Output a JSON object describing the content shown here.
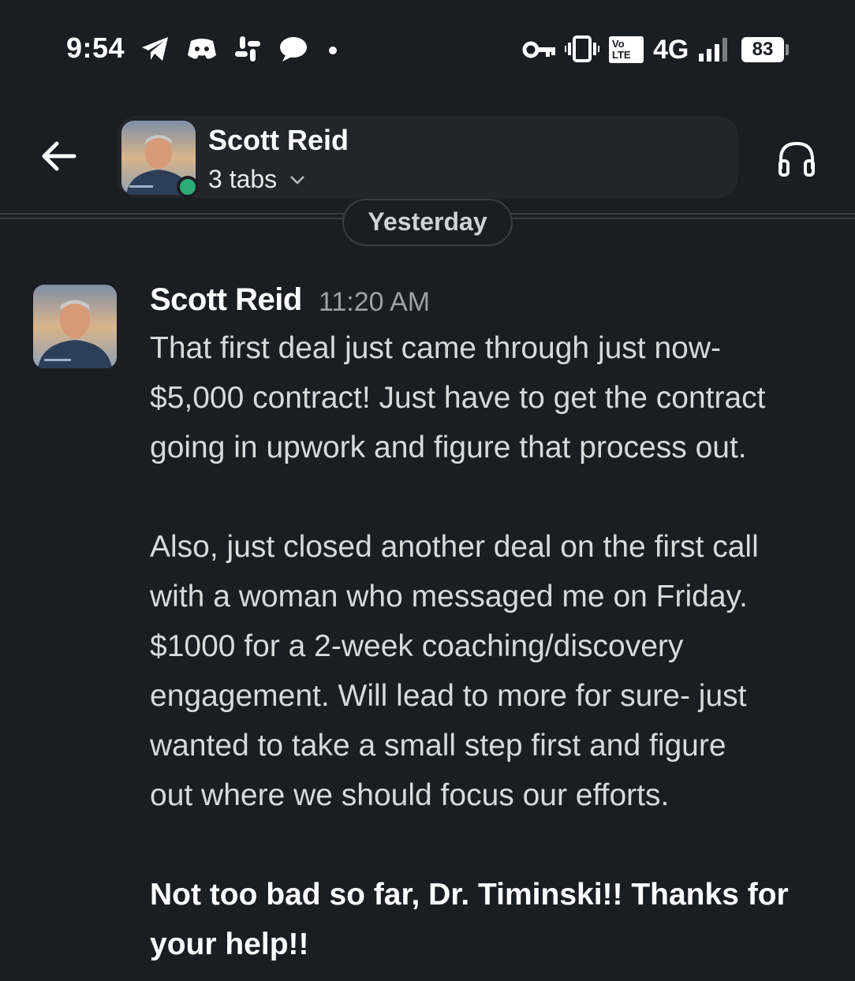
{
  "status_bar": {
    "time": "9:54",
    "network": "4G",
    "volte": "Vo\nLTE",
    "battery": "83",
    "icons": [
      "telegram-icon",
      "discord-icon",
      "slack-icon",
      "chat-bubble-icon",
      "dot-icon",
      "vpn-key-icon",
      "vibrate-icon",
      "signal-icon"
    ]
  },
  "header": {
    "name": "Scott Reid",
    "subtitle": "3 tabs",
    "presence": "online"
  },
  "divider": {
    "date_label": "Yesterday"
  },
  "message": {
    "author": "Scott Reid",
    "time": "11:20 AM",
    "paragraph_1": "That first deal just came through just now-\n$5,000 contract! Just have to get the contract\ngoing in upwork and figure that process out.",
    "paragraph_2": "Also, just closed another deal on the first call\nwith a woman who messaged me on Friday.\n$1000 for a 2-week coaching/discovery\nengagement. Will lead to more for sure- just\nwanted to take a small step first and figure\nout where we should focus our efforts.",
    "paragraph_3": "Not too bad so far, Dr. Timinski!! Thanks for\nyour help!!"
  },
  "colors": {
    "background": "#1a1d21",
    "pill": "#222529",
    "presence_green": "#2bac76",
    "text": "#d8d9da",
    "muted": "#9fa1a5"
  }
}
